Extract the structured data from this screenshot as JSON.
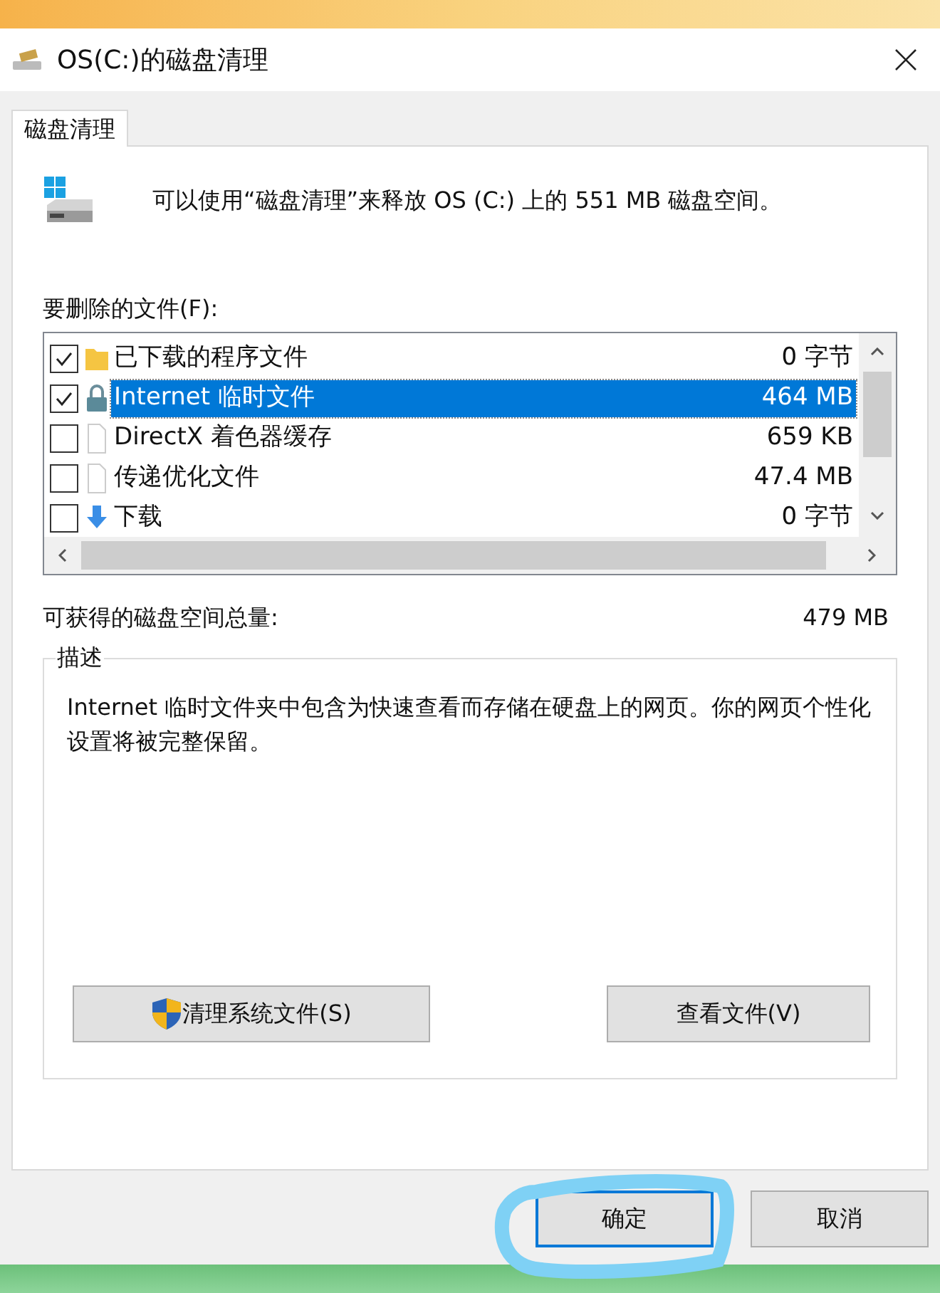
{
  "window": {
    "title": "OS(C:)的磁盘清理"
  },
  "tabs": [
    {
      "label": "磁盘清理",
      "selected": true
    }
  ],
  "intro": "可以使用“磁盘清理”来释放 OS (C:) 上的 551 MB 磁盘空间。",
  "files_label": "要删除的文件(F):",
  "files": [
    {
      "kind": "folder",
      "name": "已下载的程序文件",
      "size": "0 字节",
      "checked": true,
      "selected": false
    },
    {
      "kind": "lock",
      "name": "Internet 临时文件",
      "size": "464 MB",
      "checked": true,
      "selected": true
    },
    {
      "kind": "file",
      "name": "DirectX 着色器缓存",
      "size": "659 KB",
      "checked": false,
      "selected": false
    },
    {
      "kind": "file",
      "name": "传递优化文件",
      "size": "47.4 MB",
      "checked": false,
      "selected": false
    },
    {
      "kind": "download",
      "name": "下载",
      "size": "0 字节",
      "checked": false,
      "selected": false
    }
  ],
  "total_label": "可获得的磁盘空间总量:",
  "total_value": "479 MB",
  "description": {
    "title": "描述",
    "text": "Internet 临时文件夹中包含为快速查看而存储在硬盘上的网页。你的网页个性化设置将被完整保留。"
  },
  "panel_buttons": [
    {
      "label": "清理系统文件(S)",
      "shield": true
    },
    {
      "label": "查看文件(V)",
      "shield": false
    }
  ],
  "dialog_buttons": [
    {
      "label": "确定",
      "default": true
    },
    {
      "label": "取消",
      "default": false
    }
  ]
}
